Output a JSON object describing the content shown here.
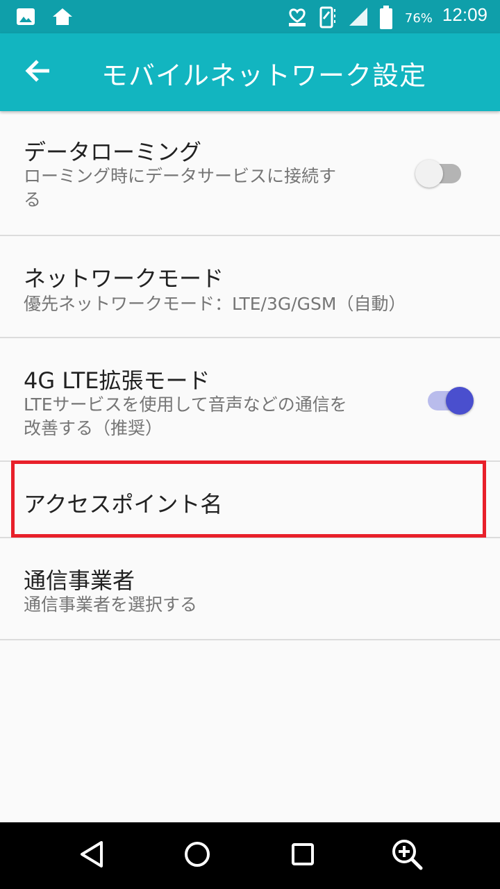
{
  "status_bar": {
    "battery_percent": "76%",
    "time": "12:09",
    "icons": [
      "image-icon",
      "home-icon",
      "notification-heart-icon",
      "vibrate-icon",
      "signal-icon",
      "battery-icon"
    ]
  },
  "app_bar": {
    "title": "モバイルネットワーク設定",
    "back_icon": "arrow-back-icon"
  },
  "settings": {
    "data_roaming": {
      "title": "データローミング",
      "summary_line1": "ローミング時にデータサービスに接続す",
      "summary_line2": "る",
      "toggle_on": false
    },
    "network_mode": {
      "title": "ネットワークモード",
      "summary": "優先ネットワークモード：LTE/3G/GSM（自動）"
    },
    "lte_enhanced": {
      "title": "4G LTE拡張モード",
      "summary_line1": "LTEサービスを使用して音声などの通信を",
      "summary_line2": "改善する（推奨）",
      "toggle_on": true
    },
    "apn": {
      "title": "アクセスポイント名"
    },
    "carrier": {
      "title": "通信事業者",
      "summary": "通信事業者を選択する"
    }
  },
  "colors": {
    "status_bar": "#0f9faa",
    "app_bar": "#12b5c0",
    "highlight": "#e8202a",
    "toggle_on_thumb": "#4a4fce",
    "toggle_on_track": "#b9bcec"
  },
  "nav_bar": {
    "icons": [
      "back-triangle-icon",
      "home-circle-icon",
      "recents-square-icon",
      "zoom-in-icon"
    ]
  }
}
